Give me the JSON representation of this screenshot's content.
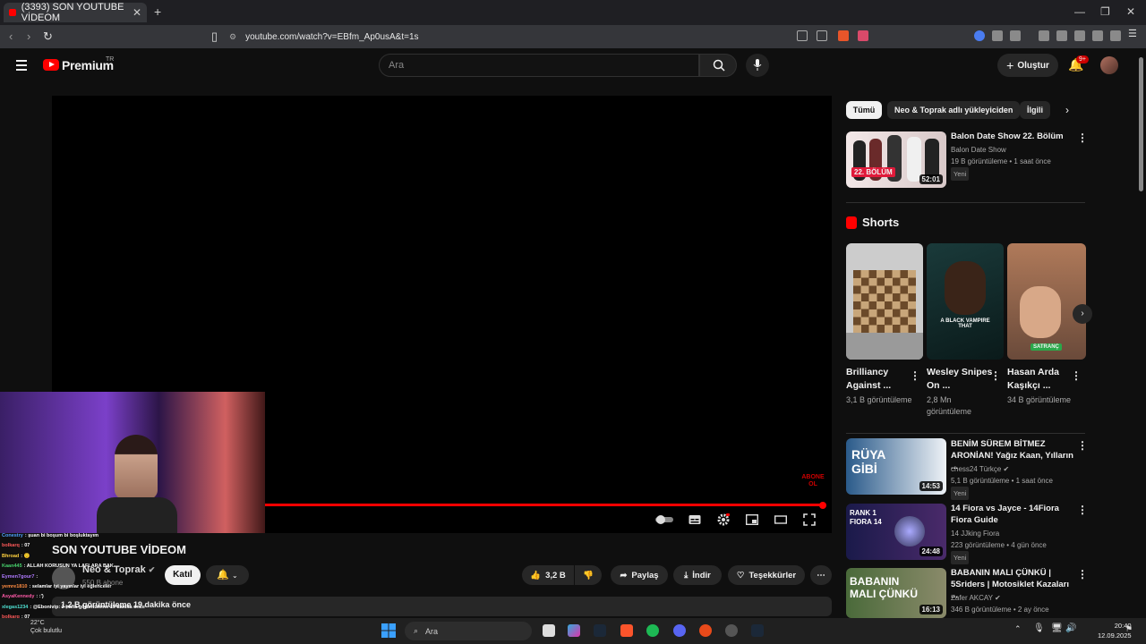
{
  "browser": {
    "tab_title": "(3393) SON YOUTUBE VİDEOM",
    "tab_close": "✕",
    "new_tab": "+",
    "url": "youtube.com/watch?v=EBfm_Ap0usA&t=1s",
    "window_controls": [
      "—",
      "❐",
      "✕"
    ]
  },
  "header": {
    "brand": "Premium",
    "region": "TR",
    "search_placeholder": "Ara",
    "create_label": "Oluştur",
    "notif_badge": "9+"
  },
  "video": {
    "title": "SON YOUTUBE VİDEOM",
    "channel": "Neo & Toprak",
    "subscribers": "550 B abone",
    "join_label": "Katıl",
    "likes": "3,2 B",
    "share_label": "Paylaş",
    "download_label": "İndir",
    "thanks_label": "Teşekkürler",
    "description": "1,2 B görüntüleme  19 dakika önce",
    "progress_fraction": 0.99,
    "overlay_logo": "ABONE OL"
  },
  "chat": [
    {
      "user": "Conestry",
      "msg": "şuan bi boşum bi boşluktayım",
      "color": "#4fa3ff"
    },
    {
      "user": "bolkarq",
      "msg": "07",
      "color": "#ff5a5a"
    },
    {
      "user": "Bhroad",
      "msg": "🙂",
      "color": "#ffd23f"
    },
    {
      "user": "Kaan445",
      "msg": "ALLAH KORUSUN YA LAFLARA BAK",
      "color": "#47d16c"
    },
    {
      "user": "Eymen7gour7",
      "msg": "",
      "color": "#b07aff"
    },
    {
      "user": "yemre1810",
      "msg": "selamlar iyi yayınlar iyi eğlenceler",
      "color": "#ff8c42"
    },
    {
      "user": "AsyaKennedy",
      "msg": ":')",
      "color": "#ff5aa8"
    },
    {
      "user": "xlegas1234",
      "msg": "@Ebonivip: 2 hafta görüntüleme 19 dakika önce",
      "color": "#4fe0d2"
    },
    {
      "user": "bolkarq",
      "msg": "07",
      "color": "#ff5a5a"
    },
    {
      "user": "gojosatoruelbonivon5487",
      "msg": "hayat bu mu lan",
      "color": "#7ab8ff"
    }
  ],
  "sidebar": {
    "chips": [
      "Tümü",
      "Neo & Toprak adlı yükleyiciden",
      "İlgili"
    ],
    "shorts_label": "Shorts",
    "top_video": {
      "title": "Balon Date Show 22. Bölüm",
      "channel": "Balon Date Show",
      "meta": "19 B görüntüleme • 1 saat önce",
      "badge": "Yeni",
      "duration": "52:01",
      "thumb_text": "22. BÖLÜM"
    },
    "shorts": [
      {
        "title": "Brilliancy Against ...",
        "views": "3,1 B görüntüleme"
      },
      {
        "title": "Wesley Snipes On ...",
        "views": "2,8 Mn görüntüleme",
        "thumb_text": "A BLACK VAMPIRE THAT"
      },
      {
        "title": "Hasan Arda Kaşıkçı ...",
        "views": "34 B görüntüleme",
        "thumb_text": "SATRANÇ"
      }
    ],
    "videos": [
      {
        "title": "BENİM SÜREM BİTMEZ ARONİAN! Yağız Kaan, Yılların ...",
        "channel": "chess24 Türkçe ✔",
        "meta": "5,1 B görüntüleme • 1 saat önce",
        "badge": "Yeni",
        "duration": "14:53",
        "thumb_text": "RÜYA GİBİ"
      },
      {
        "title": "14 Fiora vs Jayce - 14Fiora Fiora Guide",
        "channel": "14 JJking Fiora",
        "meta": "223 görüntüleme • 4 gün önce",
        "badge": "Yeni",
        "duration": "24:48",
        "thumb_text": "RANK 1 FIORA 14"
      },
      {
        "title": "BABANIN MALI ÇÜNKÜ | 5Sriders | Motosiklet Kazaları ...",
        "channel": "Zafer AKCAY ✔",
        "meta": "346 B görüntüleme • 2 ay önce",
        "duration": "16:13",
        "thumb_text": "BABANIN MALI ÇÜNKÜ"
      }
    ]
  },
  "taskbar": {
    "search": "Ara",
    "time": "20:40",
    "date": "12.09.2025",
    "temp": "22°C",
    "weather": "Çok bulutlu"
  }
}
